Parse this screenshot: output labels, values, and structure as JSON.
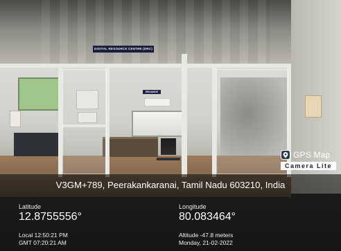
{
  "scene": {
    "ceiling_sign": "DIGITAL RESOURCE CENTRE (DRC)",
    "wall_sign": "RELIANCE"
  },
  "logo": {
    "title": "GPS Map",
    "subtitle": "Camera Lite",
    "icon": "map-pin-icon"
  },
  "location": {
    "address": "V3GM+789, Peerakankaranai, Tamil Nadu 603210, India",
    "latitude_label": "Latitude",
    "latitude_value": "12.8755556°",
    "longitude_label": "Longitude",
    "longitude_value": "80.083464°",
    "local_time": "Local 12:50:21 PM",
    "gmt_time": "GMT 07:20:21 AM",
    "altitude": "Altitude -47.8 meters",
    "date": "Monday, 21-02-2022"
  },
  "colors": {
    "overlay": "#141412",
    "text": "#ffffff"
  }
}
